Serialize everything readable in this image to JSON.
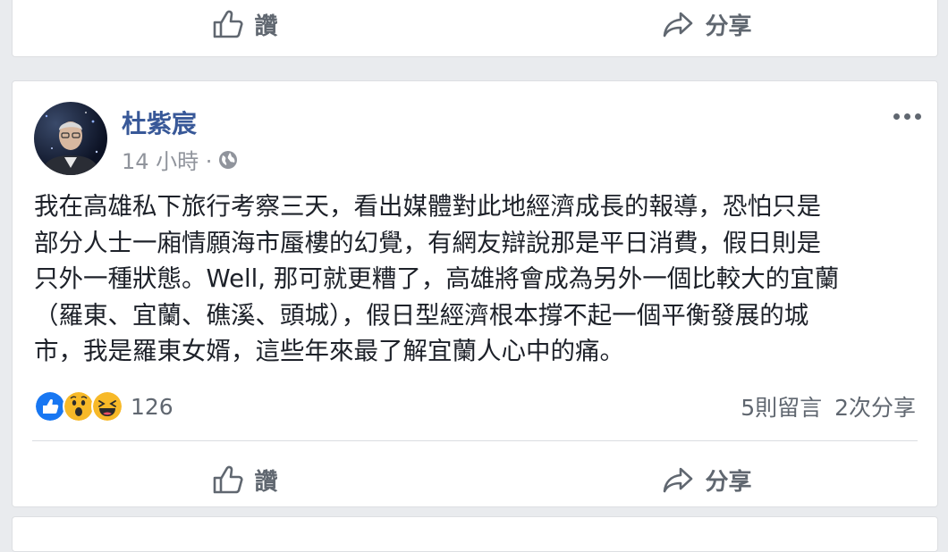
{
  "top_actions": {
    "like_label": "讚",
    "share_label": "分享"
  },
  "post": {
    "author": "杜紫宸",
    "time": "14 小時 ·",
    "text_lines": [
      "我在高雄私下旅行考察三天，看出媒體對此地經濟成長的報導，恐怕只是",
      "部分人士一廂情願海市蜃樓的幻覺，有網友辯說那是平日消費，假日則是",
      "只外一種狀態。Well, 那可就更糟了，高雄將會成為另外一個比較大的宜蘭",
      "（羅東、宜蘭、礁溪、頭城），假日型經濟根本撐不起一個平衡發展的城",
      "市，我是羅東女婿，這些年來最了解宜蘭人心中的痛。"
    ],
    "reaction_count": "126",
    "comments": "5則留言",
    "shares": "2次分享",
    "actions": {
      "like_label": "讚",
      "share_label": "分享"
    }
  },
  "colors": {
    "author": "#385898",
    "meta": "#90949c",
    "like_blue": "#1877f2",
    "emoji_yellow": "#f7b928"
  },
  "icons": [
    "like-icon",
    "share-icon",
    "globe-icon",
    "more-options-icon",
    "reaction-like-icon",
    "reaction-wow-icon",
    "reaction-haha-icon"
  ]
}
